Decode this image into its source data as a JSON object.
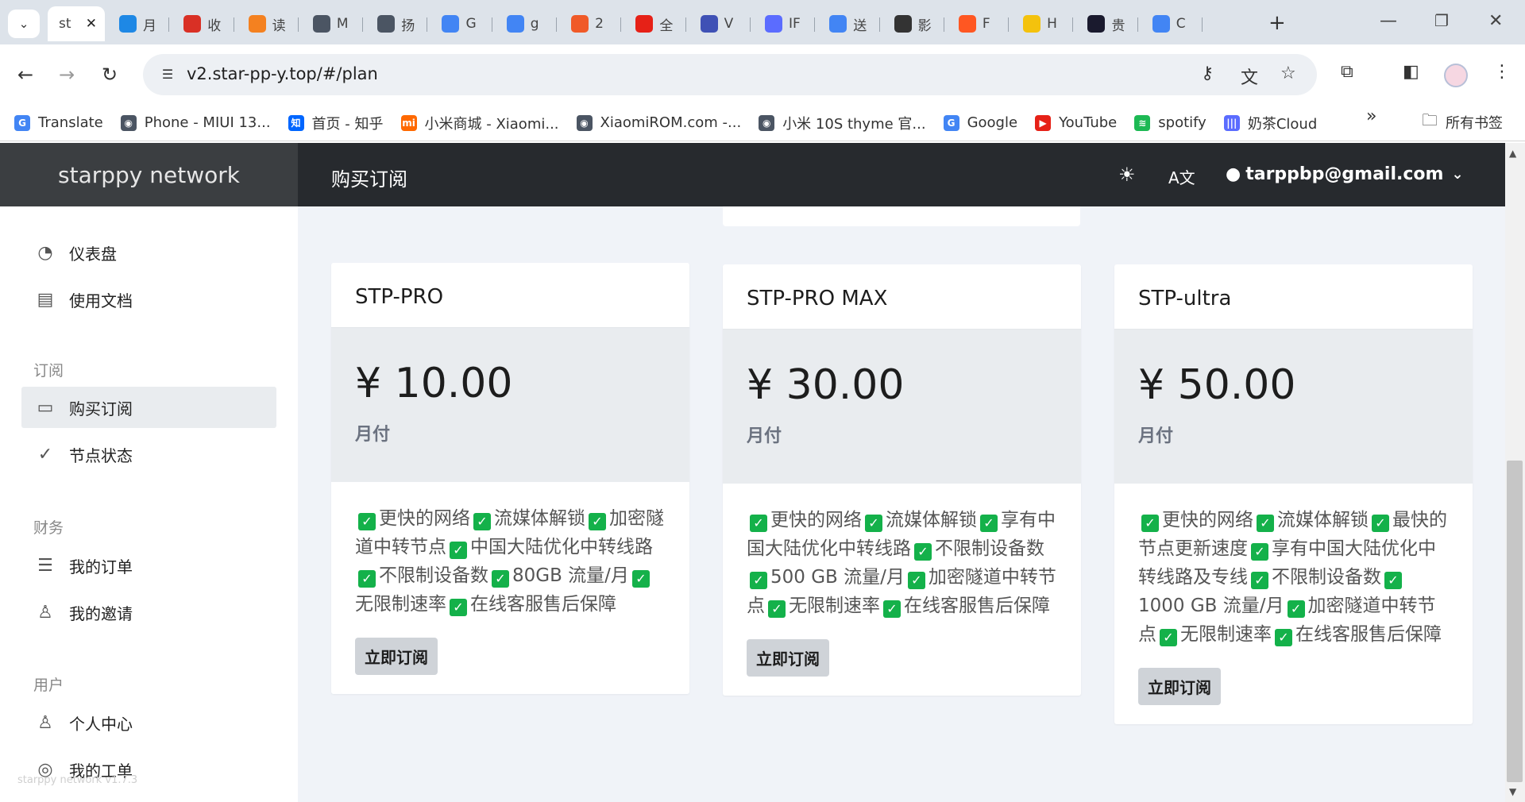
{
  "browser": {
    "active_tab": "st",
    "tabs": [
      {
        "label": "st",
        "color": "#4b5563"
      },
      {
        "label": "月",
        "color": "#1e88e5"
      },
      {
        "label": "收",
        "color": "#d93025"
      },
      {
        "label": "读",
        "color": "#f48120"
      },
      {
        "label": "M",
        "color": "#4b5563"
      },
      {
        "label": "扬",
        "color": "#4b5563"
      },
      {
        "label": "G",
        "color": "#4285f4"
      },
      {
        "label": "g",
        "color": "#4285f4"
      },
      {
        "label": "2",
        "color": "#f05a28"
      },
      {
        "label": "全",
        "color": "#e62117"
      },
      {
        "label": "V",
        "color": "#3f51b5"
      },
      {
        "label": "IF",
        "color": "#5b6cff"
      },
      {
        "label": "送",
        "color": "#4285f4"
      },
      {
        "label": "影",
        "color": "#333333"
      },
      {
        "label": "F",
        "color": "#ff5722"
      },
      {
        "label": "H",
        "color": "#f4c20d"
      },
      {
        "label": "贵",
        "color": "#1a1a2e"
      },
      {
        "label": "C",
        "color": "#4285f4"
      }
    ],
    "url": "v2.star-pp-y.top/#/plan",
    "bookmarks": [
      {
        "label": "Translate",
        "color": "#4285f4",
        "glyph": "G"
      },
      {
        "label": "Phone - MIUI 13...",
        "color": "#4b5563",
        "glyph": "◉"
      },
      {
        "label": "首页 - 知乎",
        "color": "#0066ff",
        "glyph": "知"
      },
      {
        "label": "小米商城 - Xiaomi...",
        "color": "#ff6900",
        "glyph": "mi"
      },
      {
        "label": "XiaomiROM.com -...",
        "color": "#4b5563",
        "glyph": "◉"
      },
      {
        "label": "小米 10S thyme 官...",
        "color": "#4b5563",
        "glyph": "◉"
      },
      {
        "label": "Google",
        "color": "#4285f4",
        "glyph": "G"
      },
      {
        "label": "YouTube",
        "color": "#e62117",
        "glyph": "▶"
      },
      {
        "label": "spotify",
        "color": "#1db954",
        "glyph": "≋"
      },
      {
        "label": "奶茶Cloud",
        "color": "#5b6cff",
        "glyph": "|||"
      }
    ],
    "bookmark_folder": "所有书签"
  },
  "app": {
    "brand": "starppy network",
    "page_title": "购买订阅",
    "user_email": "tarppbp@gmail.com",
    "version": "starppy network v1.7.3"
  },
  "sidebar": {
    "items": [
      {
        "label": "仪表盘",
        "icon": "dashboard-icon"
      },
      {
        "label": "使用文档",
        "icon": "book-icon"
      },
      {
        "label": "购买订阅",
        "icon": "clipboard-icon"
      },
      {
        "label": "节点状态",
        "icon": "check-circle-icon"
      },
      {
        "label": "我的订单",
        "icon": "list-icon"
      },
      {
        "label": "我的邀请",
        "icon": "invite-user-icon"
      },
      {
        "label": "个人中心",
        "icon": "user-icon"
      },
      {
        "label": "我的工单",
        "icon": "support-icon"
      }
    ],
    "headings": [
      "订阅",
      "财务",
      "用户"
    ]
  },
  "plans": [
    {
      "name": "STP-PRO",
      "price": "¥ 10.00",
      "period": "月付",
      "features": [
        "更快的网络",
        "流媒体解锁",
        "加密隧道中转节点",
        "中国大陆优化中转线路",
        "不限制设备数",
        "80GB 流量/月",
        "无限制速率",
        "在线客服售后保障"
      ],
      "button": "立即订阅"
    },
    {
      "name": "STP-PRO MAX",
      "price": "¥ 30.00",
      "period": "月付",
      "features": [
        "更快的网络",
        "流媒体解锁",
        "享有中国大陆优化中转线路",
        "不限制设备数",
        "500 GB 流量/月",
        "加密隧道中转节点",
        "无限制速率",
        "在线客服售后保障"
      ],
      "button": "立即订阅"
    },
    {
      "name": "STP-ultra",
      "price": "¥ 50.00",
      "period": "月付",
      "features": [
        "更快的网络",
        "流媒体解锁",
        "最快的节点更新速度",
        "享有中国大陆优化中转线路及专线",
        "不限制设备数",
        "1000 GB 流量/月",
        "加密隧道中转节点",
        "无限制速率",
        "在线客服售后保障"
      ],
      "button": "立即订阅"
    }
  ],
  "colors": {
    "header_bg": "#272a2e",
    "brand_bg": "#3b3e41",
    "main_bg": "#f0f3f8",
    "check": "#14b14a"
  }
}
